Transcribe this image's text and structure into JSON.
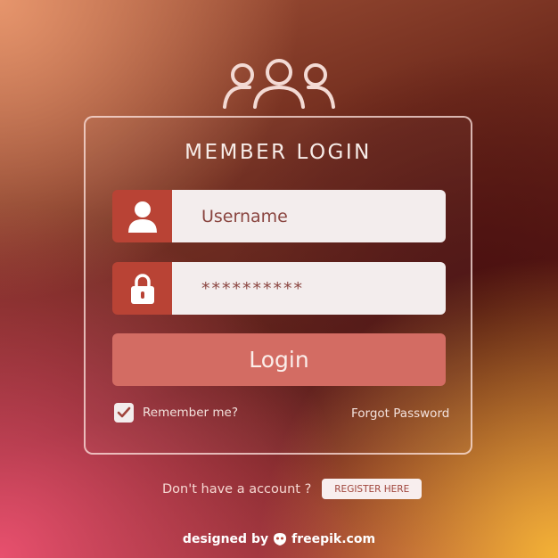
{
  "header": {
    "title": "MEMBER LOGIN"
  },
  "form": {
    "username_placeholder": "Username",
    "password_value": "**********",
    "login_label": "Login",
    "remember_label": "Remember me?",
    "remember_checked": true,
    "forgot_label": "Forgot Password"
  },
  "signup": {
    "prompt": "Don't have a account ?",
    "register_label": "REGISTER HERE"
  },
  "footer": {
    "designed_by": "designed by",
    "brand": "freepik.com"
  },
  "icons": {
    "header": "users-group-icon",
    "username": "user-icon",
    "password": "lock-icon",
    "checkbox": "checkmark-icon",
    "brand": "freepik-logo-icon"
  },
  "colors": {
    "icon_bg": "#b94335",
    "input_bg": "#f3eded",
    "button_bg": "#d36c63",
    "panel_border": "#ffe6e1"
  }
}
